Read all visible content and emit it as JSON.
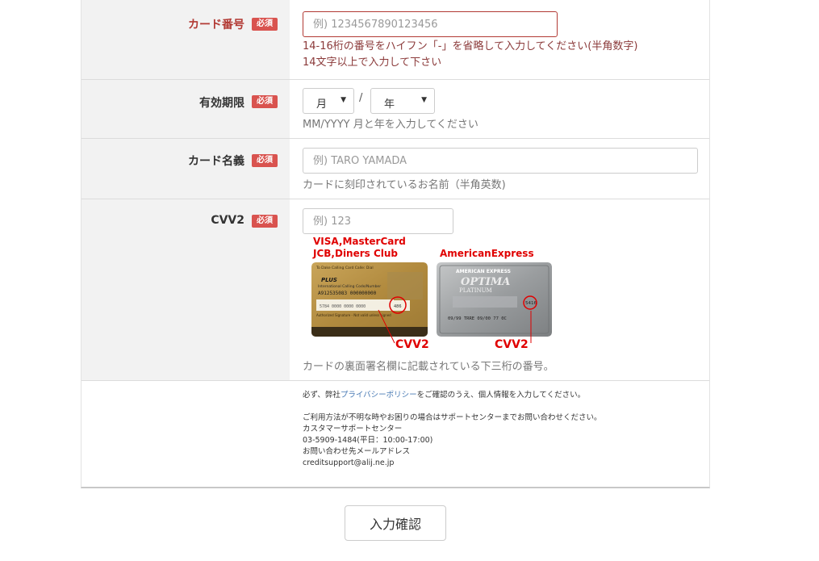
{
  "badge_required": "必須",
  "card_number": {
    "label": "カード番号",
    "placeholder": "例) 1234567890123456",
    "error_line1": "14-16桁の番号をハイフン「-」を省略して入力してください(半角数字)",
    "error_line2": "14文字以上で入力して下さい"
  },
  "expiry": {
    "label": "有効期限",
    "month_value": "月",
    "year_value": "年",
    "separator": "/",
    "help": "MM/YYYY 月と年を入力してください"
  },
  "card_name": {
    "label": "カード名義",
    "placeholder": "例) TARO YAMADA",
    "help": "カードに刻印されているお名前（半角英数)"
  },
  "cvv2": {
    "label": "CVV2",
    "placeholder": "例) 123",
    "brands_left_line1": "VISA,MasterCard",
    "brands_left_line2": "JCB,Diners Club",
    "brands_right": "AmericanExpress",
    "cvv_tag": "CVV2",
    "help": "カードの裏面署名欄に記載されている下三桁の番号。",
    "gold_card_text": {
      "l1": "To Dake Calling Card Calle: Dial",
      "brand": "PLUS",
      "l2": "International Calling Code/Number",
      "digits": "A912535083 000000000",
      "sig_nums": "5784 0000 0000 0000",
      "code": "486",
      "auth": "Authorized Signature - Not valid unless signed"
    },
    "amex_text": {
      "brand": "AMERICAN EXPRESS",
      "name": "OPTIMA",
      "tier": "PLATINUM",
      "code": "5416",
      "line": "09/99  TRRE 09/00     77   0C"
    }
  },
  "notice": {
    "l1_pre": "必ず、弊社",
    "l1_link": "プライバシーポリシー",
    "l1_post": "をご確認のうえ、個人情報を入力してください。",
    "l2": "ご利用方法が不明な時やお困りの場合はサポートセンターまでお問い合わせください。",
    "l3": "カスタマーサポートセンター",
    "l4": "03-5909-1484(平日：10:00-17:00)",
    "l5": "お問い合わせ先メールアドレス",
    "l6": "creditsupport@alij.ne.jp"
  },
  "confirm_button": "入力確認",
  "colors": {
    "required_badge": "#d9534f",
    "error_text": "#8b3a3a",
    "cvv_red": "#e00000",
    "link": "#4a7bb5"
  }
}
